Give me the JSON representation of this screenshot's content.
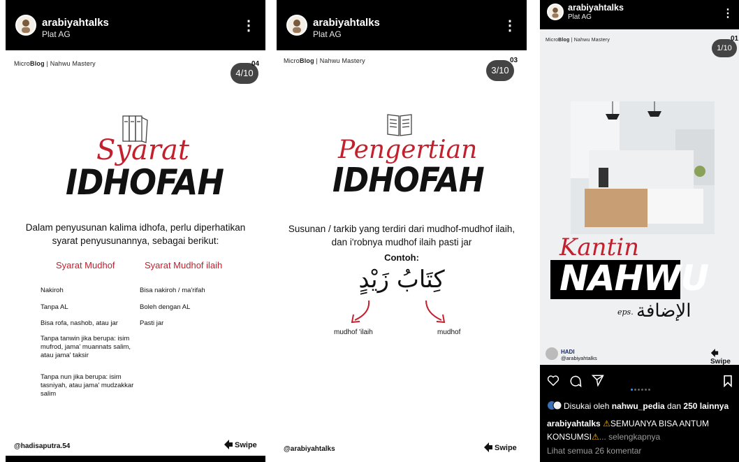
{
  "panels": [
    {
      "username": "arabiyahtalks",
      "subtitle": "Plat AG",
      "brand_light": "Micro",
      "brand_bold": "Blog",
      "brand_rest": " | Nahwu Mastery",
      "counter": "4/10",
      "corner_number": "04",
      "script_title": "Syarat",
      "big_title": "IDHOFAH",
      "paragraph_1": "Dalam penyusunan kalima idhofa, perlu diperhatikan",
      "paragraph_2": "syarat penyusunannya, sebagai berikut:",
      "col_left_title": "Syarat Mudhof",
      "col_right_title": "Syarat Mudhof ilaih",
      "left_items": [
        "Nakiroh",
        "Tanpa AL",
        "Bisa rofa, nashob, atau jar",
        "Tanpa tanwin jika berupa: isim mufrod, jama' muannats salim, atau jama' taksir",
        "Tanpa nun jika berupa: isim tasniyah, atau jama' mudzakkar salim"
      ],
      "right_items": [
        "Bisa nakiroh / ma'rifah",
        "Boleh dengan AL",
        "Pasti jar"
      ],
      "footer_handle": "@hadisaputra.54",
      "swipe": "Swipe"
    },
    {
      "username": "arabiyahtalks",
      "subtitle": "Plat AG",
      "brand_light": "Micro",
      "brand_bold": "Blog",
      "brand_rest": " | Nahwu Mastery",
      "counter": "3/10",
      "corner_number": "03",
      "script_title": "Pengertian",
      "big_title": "IDHOFAH",
      "paragraph_1": "Susunan / tarkib yang terdiri dari mudhof-mudhof ilaih,",
      "paragraph_2": "dan i'robnya mudhof ilaih pasti jar",
      "contoh": "Contoh:",
      "arabic": "كِتَابُ زَيْدٍ",
      "label_left": "mudhof 'ilaih",
      "label_right": "mudhof",
      "footer_handle": "@arabiyahtalks",
      "swipe": "Swipe"
    },
    {
      "username": "arabiyahtalks",
      "subtitle": "Plat AG",
      "brand_light": "Micro",
      "brand_bold": "Blog",
      "brand_rest": " | Nahwu Mastery",
      "counter": "1/10",
      "corner_number": "01",
      "script_title": "Kantin",
      "big_title": "NAHWU",
      "eps": "eps.",
      "arabic_title": "الإضافة",
      "author_name": "HADI",
      "author_handle": "@arabiyahtalks",
      "swipe": "Swipe",
      "likes_prefix": "Disukai oleh ",
      "likes_user": "nahwu_pedia",
      "likes_mid": " dan ",
      "likes_count": "250 lainnya",
      "caption_user": "arabiyahtalks",
      "caption_text": "SEMUANYA BISA ANTUM KONSUMSI",
      "caption_more": "... selengkapnya",
      "comments": "Lihat semua 26 komentar",
      "warning_icon": "warning-icon"
    }
  ]
}
